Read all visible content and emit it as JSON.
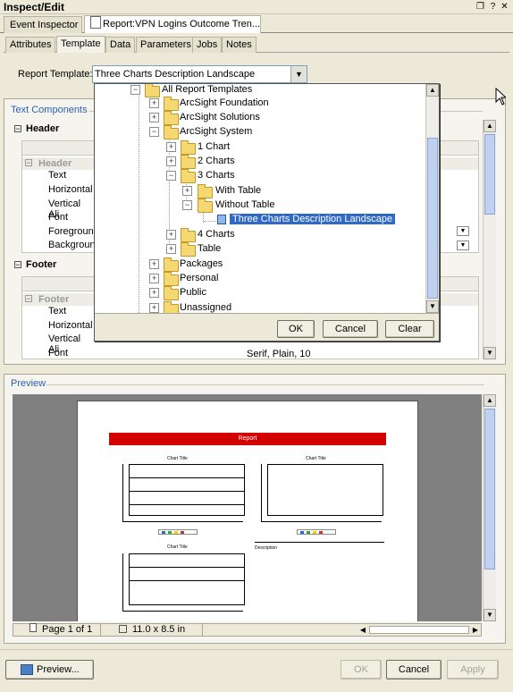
{
  "window": {
    "title": "Inspect/Edit"
  },
  "doc_tabs": [
    {
      "label": "Event Inspector"
    },
    {
      "label": "Report:VPN Logins Outcome Tren..."
    }
  ],
  "sub_tabs": [
    "Attributes",
    "Template",
    "Data",
    "Parameters",
    "Jobs",
    "Notes"
  ],
  "report_template": {
    "label": "Report Template:",
    "value": "Three Charts Description Landscape"
  },
  "text_components": {
    "title": "Text Components",
    "header": {
      "section": "Header",
      "group": "Header",
      "rows": [
        "Text",
        "Horizontal",
        "Vertical Ali",
        "Font",
        "Foregroun",
        "Backgroun"
      ]
    },
    "footer": {
      "section": "Footer",
      "group": "Footer",
      "rows": [
        "Text",
        "Horizontal",
        "Vertical Ali",
        "Font"
      ],
      "font_value": "Serif, Plain, 10"
    }
  },
  "tree": {
    "root": "All Report Templates",
    "items": [
      {
        "label": "ArcSight Foundation"
      },
      {
        "label": "ArcSight Solutions"
      },
      {
        "label": "ArcSight System"
      },
      {
        "label": "1 Chart"
      },
      {
        "label": "2 Charts"
      },
      {
        "label": "3 Charts"
      },
      {
        "label": "With Table"
      },
      {
        "label": "Without Table"
      },
      {
        "label": "Three Charts Description Landscape"
      },
      {
        "label": "4 Charts"
      },
      {
        "label": "Table"
      },
      {
        "label": "Packages"
      },
      {
        "label": "Personal"
      },
      {
        "label": "Public"
      },
      {
        "label": "Unassigned"
      }
    ],
    "buttons": {
      "ok": "OK",
      "cancel": "Cancel",
      "clear": "Clear"
    }
  },
  "preview": {
    "title": "Preview",
    "report_bar": "Report",
    "chart_title": "Chart Title",
    "description": "Description",
    "status": {
      "page": "Page 1 of 1",
      "size": "11.0 x 8.5 in"
    }
  },
  "footer_buttons": {
    "preview": "Preview...",
    "ok": "OK",
    "cancel": "Cancel",
    "apply": "Apply"
  },
  "colors": {
    "selection": "#316ac5",
    "report_bar": "#d40000",
    "legend": [
      "#3366cc",
      "#33aa33",
      "#ffcc00",
      "#cc3333"
    ]
  }
}
